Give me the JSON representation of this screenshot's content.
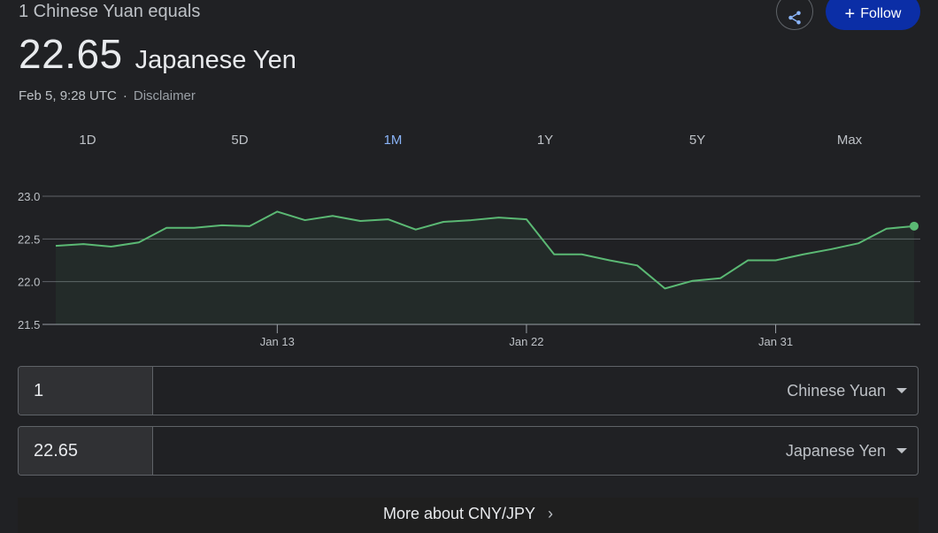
{
  "header": {
    "equals_text": "1 Chinese Yuan equals",
    "rate_value": "22.65",
    "rate_currency": "Japanese Yen",
    "timestamp": "Feb 5, 9:28 UTC",
    "separator": "·",
    "disclaimer": "Disclaimer"
  },
  "actions": {
    "share_icon": "share-icon",
    "follow_label": "Follow",
    "follow_icon": "plus-icon"
  },
  "tabs": [
    {
      "label": "1D",
      "active": false
    },
    {
      "label": "5D",
      "active": false
    },
    {
      "label": "1M",
      "active": true
    },
    {
      "label": "1Y",
      "active": false
    },
    {
      "label": "5Y",
      "active": false
    },
    {
      "label": "Max",
      "active": false
    }
  ],
  "colors": {
    "line": "#5bb974",
    "accent_blue": "#8ab4f8",
    "follow_bg": "#0b2ea6"
  },
  "chart_data": {
    "type": "line",
    "ylim": [
      21.5,
      23.0
    ],
    "yticks": [
      "23.0",
      "22.5",
      "22.0",
      "21.5"
    ],
    "xtick_labels": [
      {
        "label": "Jan 13",
        "index": 8
      },
      {
        "label": "Jan 22",
        "index": 17
      },
      {
        "label": "Jan 31",
        "index": 26
      }
    ],
    "grid": true,
    "series": [
      {
        "values": [
          22.42,
          22.44,
          22.41,
          22.46,
          22.63,
          22.63,
          22.66,
          22.65,
          22.82,
          22.72,
          22.77,
          22.71,
          22.73,
          22.61,
          22.7,
          22.72,
          22.75,
          22.73,
          22.32,
          22.32,
          22.25,
          22.19,
          21.92,
          22.01,
          22.04,
          22.25,
          22.25,
          22.32,
          22.38,
          22.45,
          22.62,
          22.65
        ]
      }
    ]
  },
  "converter": {
    "from_amount": "1",
    "from_currency": "Chinese Yuan",
    "to_amount": "22.65",
    "to_currency": "Japanese Yen"
  },
  "more_link": {
    "label": "More about CNY/JPY"
  }
}
